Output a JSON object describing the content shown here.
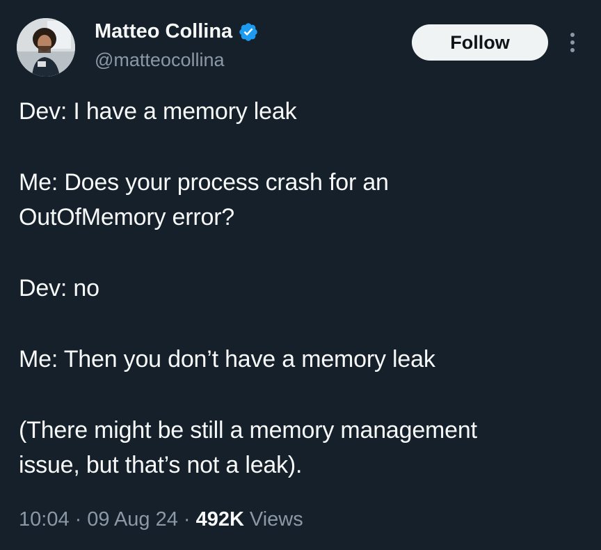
{
  "author": {
    "display_name": "Matteo Collina",
    "handle": "@matteocollina",
    "verified": true,
    "verified_color": "#1d9bf0",
    "avatar_icon": "profile-photo"
  },
  "actions": {
    "follow_label": "Follow",
    "more_icon": "more-vertical-icon"
  },
  "tweet": {
    "paragraphs": [
      [
        "Dev: I have a memory leak"
      ],
      [
        "Me: Does your process crash for an",
        "OutOfMemory error?"
      ],
      [
        "Dev: no"
      ],
      [
        "Me: Then you don’t have a memory leak"
      ],
      [
        "(There might be still a memory management",
        "issue, but that’s not a leak)."
      ]
    ]
  },
  "meta": {
    "time": "10:04",
    "separator": "·",
    "date": "09 Aug 24",
    "views_count": "492K",
    "views_label": "Views"
  },
  "colors": {
    "background": "#15202b",
    "text_primary": "#f7f9f9",
    "text_secondary": "#8b98a5",
    "button_bg": "#eff3f4",
    "button_text": "#0f1419"
  }
}
